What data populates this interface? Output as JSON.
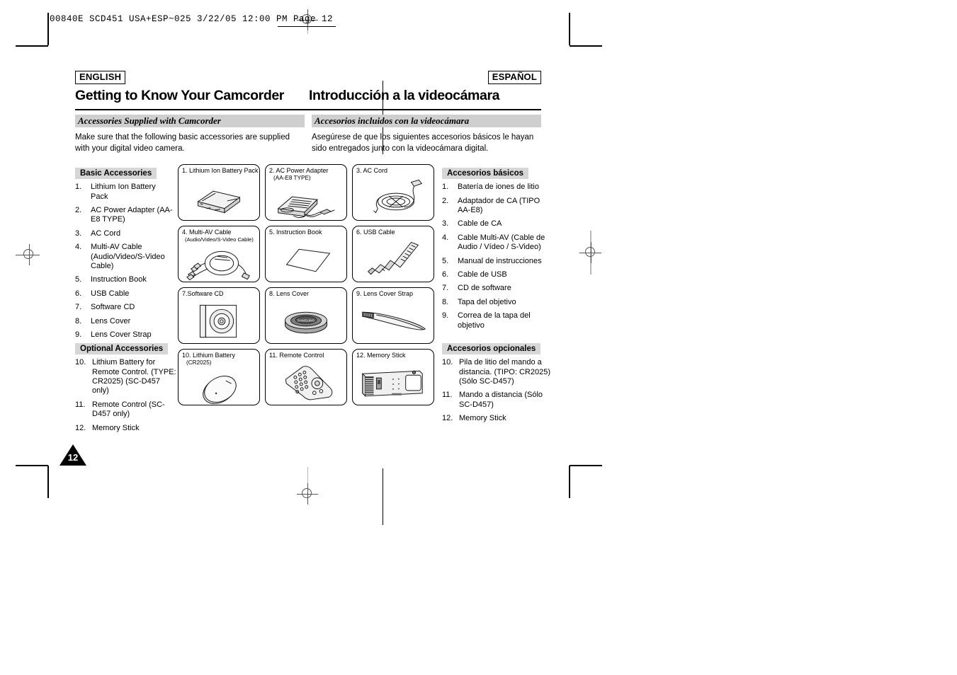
{
  "prepress": {
    "slug": "00840E  SCD451  USA+ESP~025   3/22/05 12:00 PM   Page 12"
  },
  "header": {
    "lang_left": "ENGLISH",
    "lang_right": "ESPAÑOL",
    "title_left": "Getting to Know Your Camcorder",
    "title_right": "Introducción a la videocámara"
  },
  "section": {
    "subbar_left": "Accessories Supplied with Camcorder",
    "subbar_right": "Accesorios incluidos con la videocámara",
    "intro_left": "Make sure that the following basic accessories are supplied with your digital video camera.",
    "intro_right": "Asegúrese de que los siguientes accesorios básicos le hayan sido entregados junto con la videocámara digital."
  },
  "english": {
    "basic_heading": "Basic Accessories",
    "basic_items": [
      {
        "num": "1.",
        "text": "Lithium Ion Battery Pack"
      },
      {
        "num": "2.",
        "text": "AC Power Adapter (AA-E8 TYPE)"
      },
      {
        "num": "3.",
        "text": "AC Cord"
      },
      {
        "num": "4.",
        "text": "Multi-AV Cable (Audio/Video/S-Video Cable)"
      },
      {
        "num": "5.",
        "text": "Instruction Book"
      },
      {
        "num": "6.",
        "text": "USB Cable"
      },
      {
        "num": "7.",
        "text": "Software CD"
      },
      {
        "num": "8.",
        "text": "Lens Cover"
      },
      {
        "num": "9.",
        "text": "Lens Cover Strap"
      }
    ],
    "optional_heading": "Optional Accessories",
    "optional_items": [
      {
        "num": "10.",
        "text": "Lithium Battery for Remote Control. (TYPE: CR2025) (SC-D457 only)"
      },
      {
        "num": "11.",
        "text": "Remote Control (SC-D457 only)"
      },
      {
        "num": "12.",
        "text": "Memory Stick"
      }
    ]
  },
  "spanish": {
    "basic_heading": "Accesorios básicos",
    "basic_items": [
      {
        "num": "1.",
        "text": "Batería de iones de litio"
      },
      {
        "num": "2.",
        "text": "Adaptador de CA (TIPO AA-E8)"
      },
      {
        "num": "3.",
        "text": "Cable de CA"
      },
      {
        "num": "4.",
        "text": "Cable Multi-AV (Cable de Audio / Vídeo / S-Video)"
      },
      {
        "num": "5.",
        "text": "Manual de instrucciones"
      },
      {
        "num": "6.",
        "text": "Cable de USB"
      },
      {
        "num": "7.",
        "text": "CD de software"
      },
      {
        "num": "8.",
        "text": "Tapa del objetivo"
      },
      {
        "num": "9.",
        "text": "Correa de la tapa del objetivo"
      }
    ],
    "optional_heading": "Accesorios opcionales",
    "optional_items": [
      {
        "num": "10.",
        "text": "Pila de litio del mando a distancia. (TIPO: CR2025) (Sólo SC-D457)"
      },
      {
        "num": "11.",
        "text": "Mando a distancia (Sólo SC-D457)"
      },
      {
        "num": "12.",
        "text": "Memory Stick"
      }
    ]
  },
  "grid": {
    "cells": [
      {
        "caption": "1. Lithium Ion Battery Pack",
        "caption2": "",
        "art": "battery-pack-illustration"
      },
      {
        "caption": "2. AC Power Adapter",
        "caption2": "(AA-E8 TYPE)",
        "art": "ac-power-adapter-illustration"
      },
      {
        "caption": "3. AC Cord",
        "caption2": "",
        "art": "ac-cord-illustration"
      },
      {
        "caption": "4. Multi-AV Cable",
        "caption2": "(Audio/Video/S-Video Cable)",
        "art": "multi-av-cable-illustration"
      },
      {
        "caption": "5. Instruction Book",
        "caption2": "",
        "art": "instruction-book-illustration"
      },
      {
        "caption": "6. USB Cable",
        "caption2": "",
        "art": "usb-cable-illustration"
      },
      {
        "caption": "7.Software CD",
        "caption2": "",
        "art": "software-cd-illustration"
      },
      {
        "caption": "8. Lens Cover",
        "caption2": "",
        "art": "lens-cover-illustration"
      },
      {
        "caption": "9. Lens Cover Strap",
        "caption2": "",
        "art": "lens-cover-strap-illustration"
      },
      {
        "caption": "10. Lithium Battery",
        "caption2": "(CR2025)",
        "art": "coin-battery-illustration"
      },
      {
        "caption": "11. Remote Control",
        "caption2": "",
        "art": "remote-control-illustration"
      },
      {
        "caption": "12. Memory Stick",
        "caption2": "",
        "art": "memory-stick-illustration"
      }
    ]
  },
  "footer": {
    "page_number": "12"
  }
}
